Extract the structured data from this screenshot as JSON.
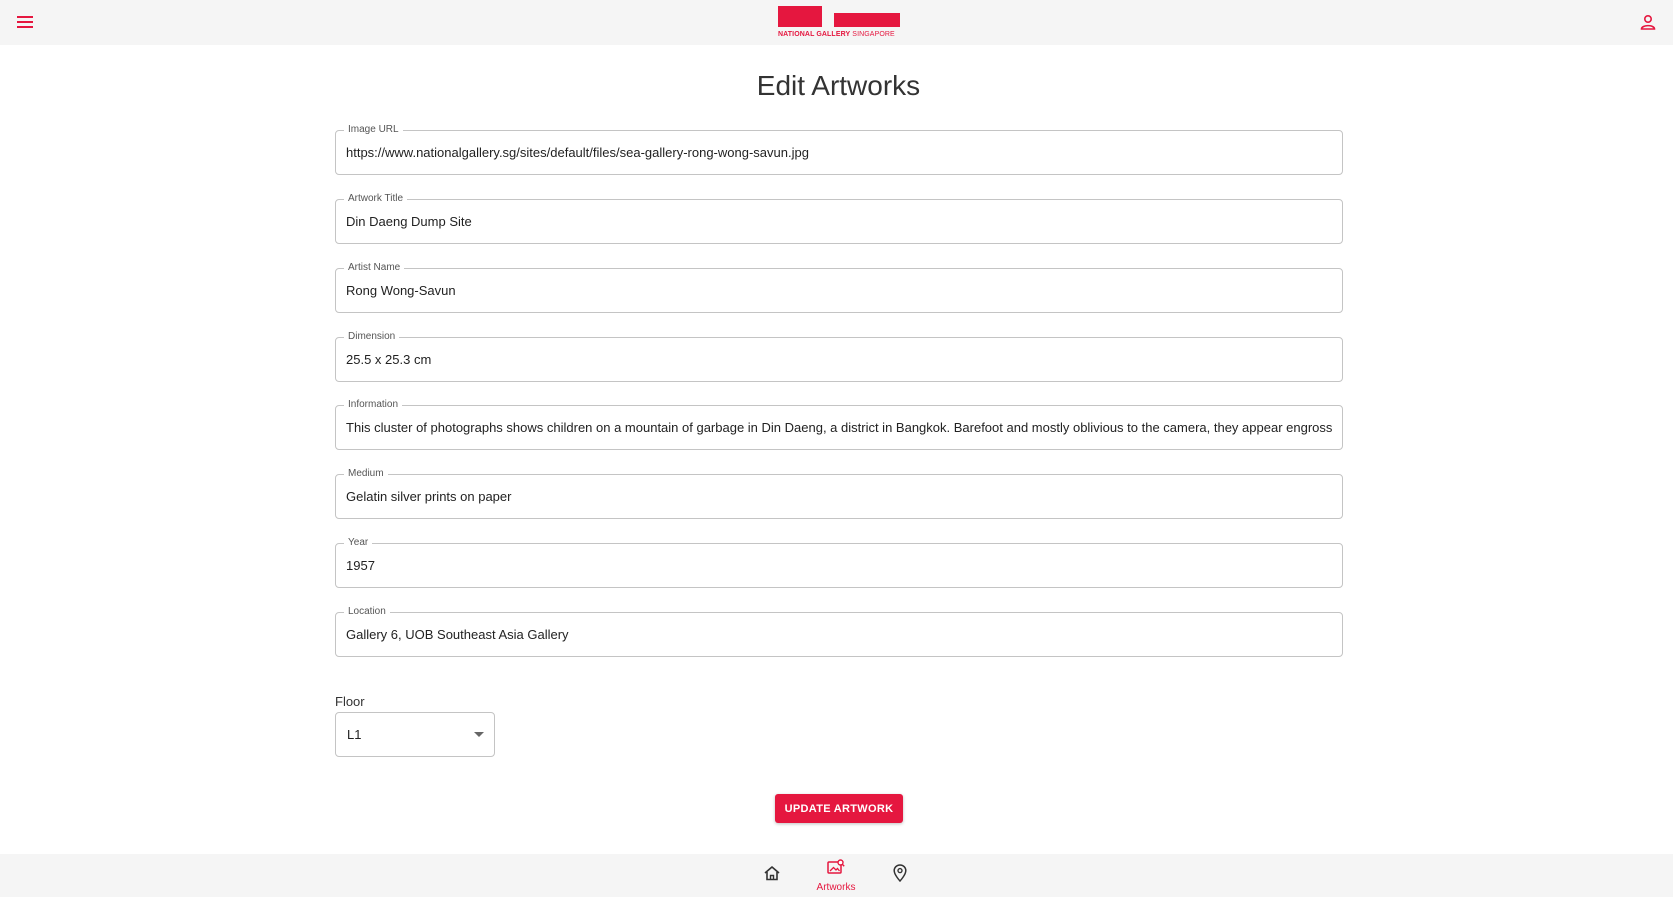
{
  "header": {
    "menu_icon": "hamburger-menu-icon",
    "user_icon": "person-icon",
    "logo": {
      "text_bold": "NATIONAL GALLERY",
      "text_light": " SINGAPORE",
      "brand_color": "#e5173f"
    }
  },
  "page_title": "Edit Artworks",
  "form": {
    "image_url": {
      "label": "Image URL",
      "value": "https://www.nationalgallery.sg/sites/default/files/sea-gallery-rong-wong-savun.jpg"
    },
    "artwork_title": {
      "label": "Artwork Title",
      "value": "Din Daeng Dump Site"
    },
    "artist_name": {
      "label": "Artist Name",
      "value": "Rong Wong-Savun"
    },
    "dimension": {
      "label": "Dimension",
      "value": "25.5 x 25.3 cm"
    },
    "information": {
      "label": "Information",
      "value": "This cluster of photographs shows children on a mountain of garbage in Din Daeng, a district in Bangkok. Barefoot and mostly oblivious to the camera, they appear engrossed"
    },
    "medium": {
      "label": "Medium",
      "value": "Gelatin silver prints on paper"
    },
    "year": {
      "label": "Year",
      "value": "1957"
    },
    "location": {
      "label": "Location",
      "value": "Gallery 6, UOB Southeast Asia Gallery"
    },
    "floor": {
      "label": "Floor",
      "value": "L1"
    },
    "submit_label": "UPDATE ARTWORK"
  },
  "bottom_nav": {
    "home_icon": "home-icon",
    "artworks_icon": "image-search-icon",
    "artworks_label": "Artworks",
    "location_icon": "map-pin-icon",
    "active": "Artworks"
  },
  "colors": {
    "accent": "#e5173f",
    "bar_background": "#f5f5f5",
    "field_border": "#c4c4c4"
  }
}
